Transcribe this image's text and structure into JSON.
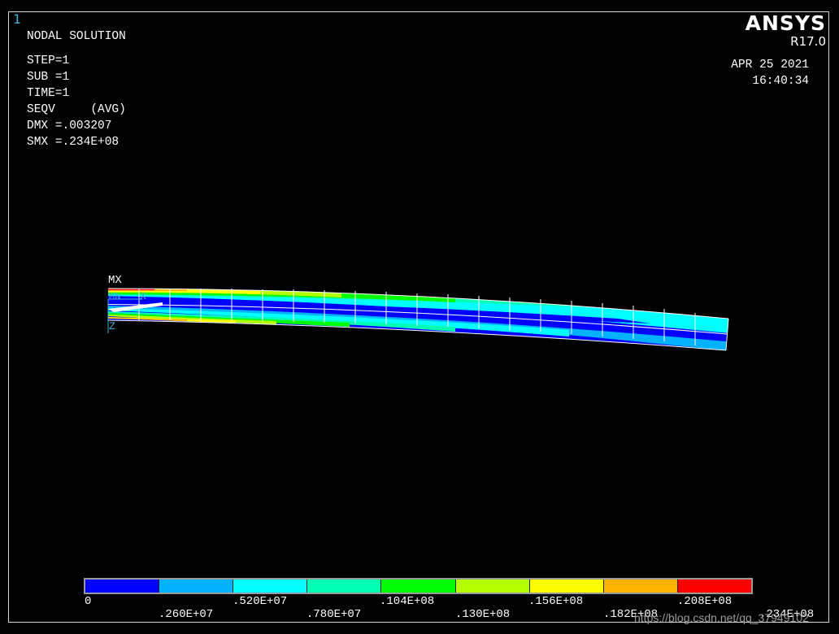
{
  "window": {
    "number": "1"
  },
  "brand": {
    "logo": "ANSYS",
    "version": "R17.0"
  },
  "info": {
    "title": "NODAL SOLUTION",
    "lines": [
      "STEP=1",
      "SUB =1",
      "TIME=1",
      "SEQV     (AVG)",
      "DMX =.003207",
      "SMX =.234E+08"
    ]
  },
  "datetime": {
    "date": "APR 25 2021",
    "time": "16:40:34"
  },
  "model": {
    "labels": {
      "mx": "MX",
      "mn": "MN",
      "x": "X",
      "z": "Z"
    }
  },
  "legend": {
    "colors": [
      "#0000ff",
      "#00b2ff",
      "#00ffff",
      "#00ffb2",
      "#00ff00",
      "#b2ff00",
      "#ffff00",
      "#ffb200",
      "#ff0000"
    ],
    "labels_top": [
      "0",
      ".520E+07",
      ".104E+08",
      ".156E+08",
      ".208E+08"
    ],
    "labels_bottom": [
      ".260E+07",
      ".780E+07",
      ".130E+08",
      ".182E+08",
      ".234E+08"
    ]
  },
  "watermark": "https://blog.csdn.net/qq_37949102"
}
